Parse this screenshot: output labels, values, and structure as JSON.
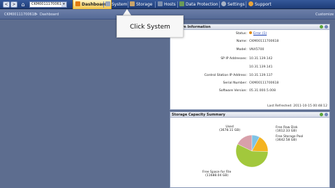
{
  "nav": {
    "back_label": "<",
    "forward_label": ">",
    "home_icon": "home-icon",
    "system_selector_value": "CKM00111700618",
    "tabs": [
      {
        "label": "Dashboard",
        "icon": "dashboard-icon",
        "active": true
      },
      {
        "label": "System",
        "icon": "system-icon",
        "active": false
      },
      {
        "label": "Storage",
        "icon": "storage-icon",
        "active": false
      },
      {
        "label": "Hosts",
        "icon": "hosts-icon",
        "active": false
      },
      {
        "label": "Data Protection",
        "icon": "data-protection-icon",
        "active": false
      },
      {
        "label": "Settings",
        "icon": "settings-icon",
        "active": false
      },
      {
        "label": "Support",
        "icon": "support-icon",
        "active": false
      }
    ]
  },
  "breadcrumb": {
    "system": "CKM00111700618",
    "separator": ">",
    "page": "Dashboard",
    "customize": "Customize"
  },
  "callout": {
    "text": "Click System"
  },
  "system_info": {
    "title": "System Information",
    "rows": [
      {
        "label": "Status:",
        "value": "Error (1)",
        "link": true
      },
      {
        "label": "Name:",
        "value": "CKM00111700618"
      },
      {
        "label": "Model:",
        "value": "VNX5700"
      },
      {
        "label": "SP IP Addresses:",
        "value": "10.31.139.142"
      },
      {
        "label": "",
        "value": "10.31.139.141"
      },
      {
        "label": "Control Station IP Address:",
        "value": "10.31.139.137"
      },
      {
        "label": "Serial Number:",
        "value": "CKM00111700618"
      },
      {
        "label": "Software Version:",
        "value": "05.31.000.5.008"
      }
    ],
    "last_refreshed": "Last Refreshed: 2011-10-15 00:48:12"
  },
  "capacity": {
    "title": "Storage Capacity Summary",
    "labels": {
      "used": [
        "Used",
        "(3678.11 GB)"
      ],
      "free_raw": [
        "Free Raw Disk",
        "(1612.33 GB)"
      ],
      "free_pool": [
        "Free Storage Pool",
        "(3642.58 GB)"
      ],
      "free_file": [
        "Free Space for File",
        "(11688.04 GB)"
      ]
    }
  },
  "colors": {
    "used": "#d8a0aa",
    "free_raw": "#7ec3e6",
    "free_pool": "#f4b321",
    "free_file": "#a2c83c"
  },
  "chart_data": {
    "type": "pie",
    "title": "Storage Capacity Summary",
    "slices": [
      {
        "label": "Used",
        "value": 3678.11
      },
      {
        "label": "Free Raw Disk",
        "value": 1612.33
      },
      {
        "label": "Free Storage Pool",
        "value": 3642.58
      },
      {
        "label": "Free Space for File",
        "value": 11688.04
      }
    ],
    "unit": "GB"
  }
}
